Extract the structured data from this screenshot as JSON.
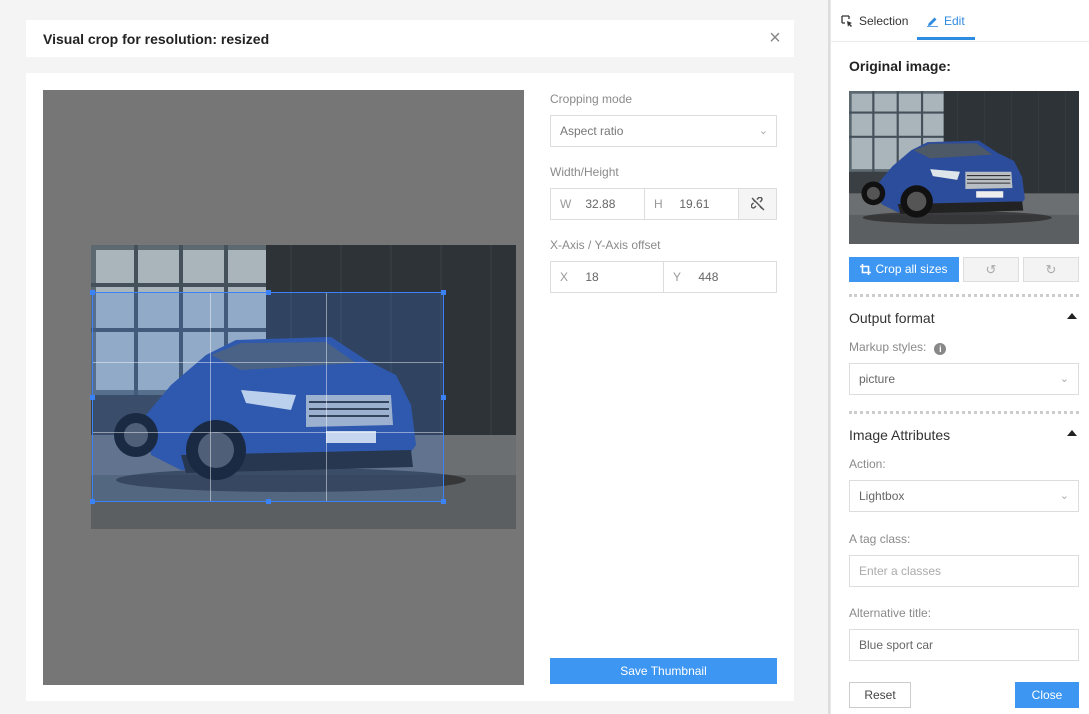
{
  "modal": {
    "title": "Visual crop for resolution: resized",
    "close_glyph": "×"
  },
  "form": {
    "cropping_mode_label": "Cropping mode",
    "cropping_mode_value": "Aspect ratio",
    "width_height_label": "Width/Height",
    "w_key": "W",
    "w_value": "32.88",
    "h_key": "H",
    "h_value": "19.61",
    "offset_label": "X-Axis / Y-Axis offset",
    "x_key": "X",
    "x_value": "18",
    "y_key": "Y",
    "y_value": "448",
    "save_label": "Save Thumbnail"
  },
  "tabs": [
    {
      "label": "Selection",
      "icon": "selection-icon",
      "active": false
    },
    {
      "label": "Edit",
      "icon": "pencil-icon",
      "active": true
    }
  ],
  "panel": {
    "original_image_title": "Original image:",
    "crop_all_label": "Crop all sizes",
    "undo_icon": "rotate-left-icon",
    "redo_icon": "rotate-right-icon",
    "output_format_title": "Output format",
    "markup_styles_label": "Markup styles:",
    "markup_styles_value": "picture",
    "image_attributes_title": "Image Attributes",
    "action_label": "Action:",
    "action_value": "Lightbox",
    "tag_class_label": "A tag class:",
    "tag_class_placeholder": "Enter a classes",
    "alt_title_label": "Alternative title:",
    "alt_title_value": "Blue sport car",
    "reset_label": "Reset",
    "close_label": "Close"
  },
  "colors": {
    "accent": "#3d97f2",
    "tab_active": "#2f8be0",
    "car_blue": "#2c4c9c"
  }
}
